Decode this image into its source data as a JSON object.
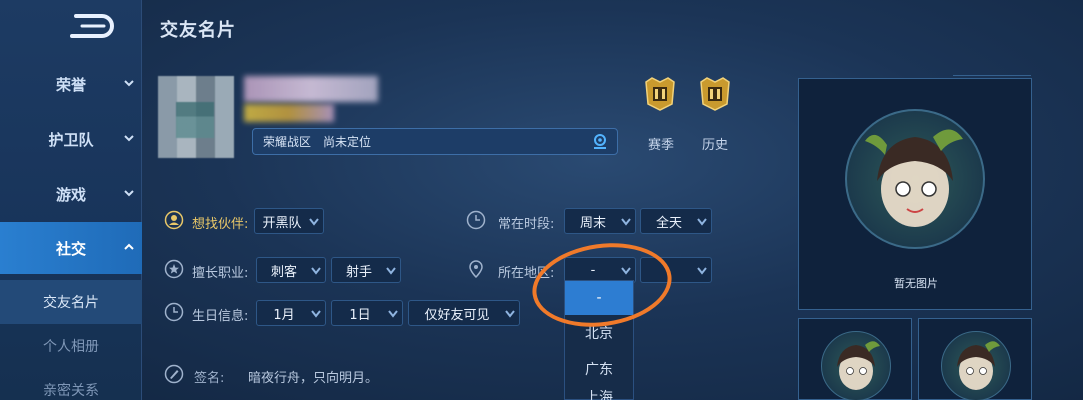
{
  "header": {
    "title": "交友名片"
  },
  "sidebar": {
    "items": [
      {
        "label": "荣誉"
      },
      {
        "label": "护卫队"
      },
      {
        "label": "游戏"
      },
      {
        "label": "社交"
      }
    ],
    "sub_items": [
      {
        "label": "交友名片"
      },
      {
        "label": "个人相册"
      },
      {
        "label": "亲密关系"
      }
    ]
  },
  "profile": {
    "zone": "荣耀战区",
    "location_status": "尚未定位"
  },
  "medals": {
    "season_label": "赛季",
    "history_label": "历史"
  },
  "filters": {
    "partner": {
      "label": "想找伙伴:",
      "value": "开黑队"
    },
    "time": {
      "label": "常在时段:",
      "value1": "周末",
      "value2": "全天"
    },
    "role": {
      "label": "擅长职业:",
      "value1": "刺客",
      "value2": "射手"
    },
    "region": {
      "label": "所在地区:",
      "value1": "-",
      "value2": ""
    },
    "birthday": {
      "label": "生日信息:",
      "month": "1月",
      "day": "1日",
      "visibility": "仅好友可见"
    },
    "signature": {
      "label": "签名:",
      "value": "暗夜行舟，只向明月。"
    }
  },
  "region_dropdown": {
    "options": [
      "-",
      "北京",
      "广东",
      "上海"
    ],
    "selected_index": 0
  },
  "photos": {
    "caption": "暂无图片"
  },
  "colors": {
    "accent_blue": "#2d7dd2",
    "gold": "#e8c768",
    "annotation_orange": "#f07a2a"
  }
}
